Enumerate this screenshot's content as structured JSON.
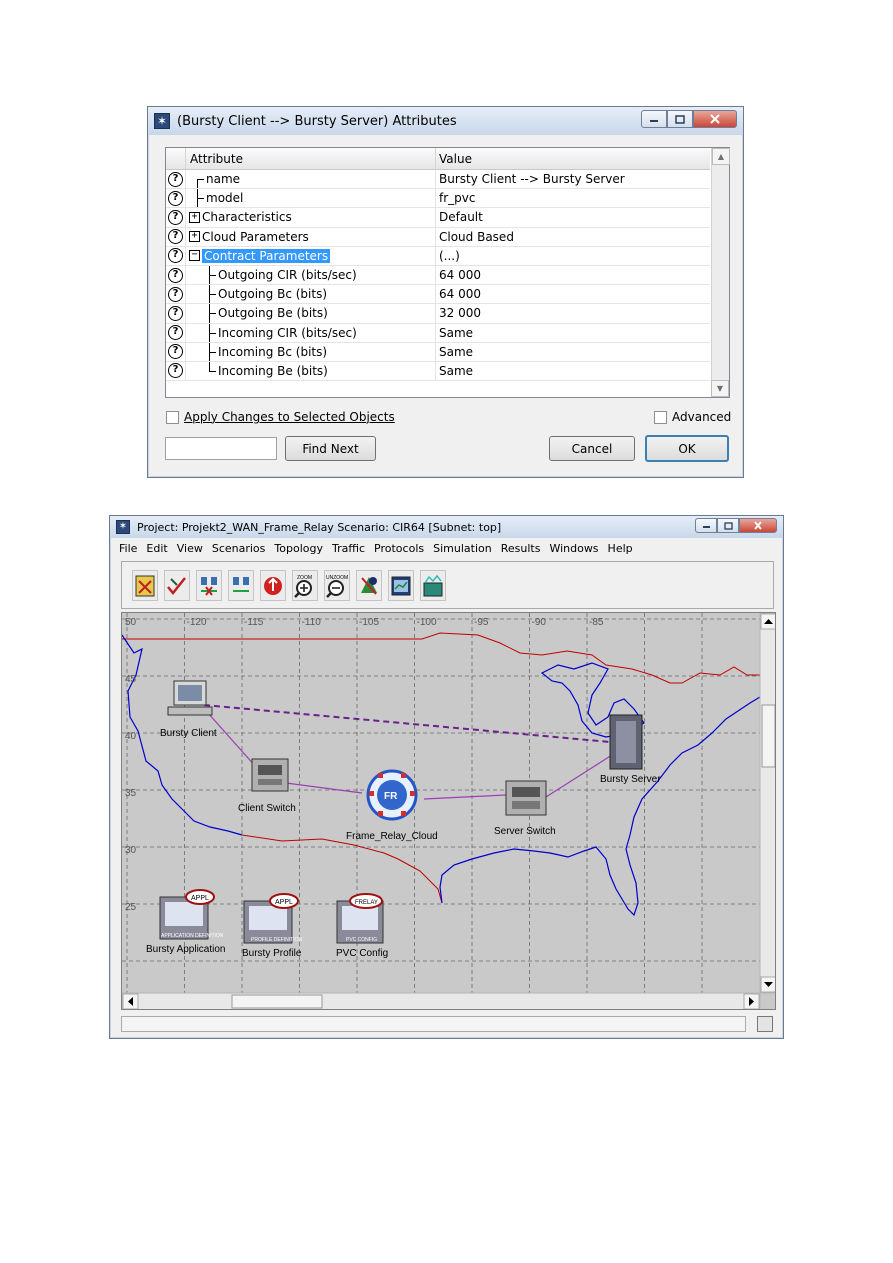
{
  "dialog": {
    "title": "(Bursty Client --> Bursty Server) Attributes",
    "columns": {
      "attribute": "Attribute",
      "value": "Value"
    },
    "rows": [
      {
        "attr": "name",
        "value": "Bursty Client --> Bursty Server",
        "tree": "first",
        "expander": ""
      },
      {
        "attr": "model",
        "value": "fr_pvc",
        "tree": "mid",
        "expander": ""
      },
      {
        "attr": "Characteristics",
        "value": "Default",
        "tree": "",
        "expander": "+"
      },
      {
        "attr": "Cloud Parameters",
        "value": "Cloud Based",
        "tree": "",
        "expander": "+"
      },
      {
        "attr": "Contract Parameters",
        "value": "(...)",
        "tree": "",
        "expander": "−",
        "selected": true
      },
      {
        "attr": "Outgoing CIR (bits/sec)",
        "value": "64 000",
        "tree": "child",
        "expander": ""
      },
      {
        "attr": "Outgoing Bc (bits)",
        "value": "64 000",
        "tree": "child",
        "expander": ""
      },
      {
        "attr": "Outgoing Be (bits)",
        "value": "32 000",
        "tree": "child",
        "expander": ""
      },
      {
        "attr": "Incoming CIR (bits/sec)",
        "value": "Same",
        "tree": "child",
        "expander": ""
      },
      {
        "attr": "Incoming Bc (bits)",
        "value": "Same",
        "tree": "child",
        "expander": ""
      },
      {
        "attr": "Incoming Be (bits)",
        "value": "Same",
        "tree": "childlast",
        "expander": ""
      }
    ],
    "apply_changes_label": "Apply Changes to Selected Objects",
    "advanced_label": "Advanced",
    "find_next_label": "Find Next",
    "find_value": "",
    "cancel_label": "Cancel",
    "ok_label": "OK"
  },
  "main": {
    "title": "Project: Projekt2_WAN_Frame_Relay Scenario: CIR64  [Subnet: top]",
    "menu": [
      "File",
      "Edit",
      "View",
      "Scenarios",
      "Topology",
      "Traffic",
      "Protocols",
      "Simulation",
      "Results",
      "Windows",
      "Help"
    ],
    "toolbar_icons": [
      "object-palette-icon",
      "verify-links-icon",
      "fail-links-icon",
      "recover-links-icon",
      "return-to-parent-icon",
      "zoom-icon",
      "unzoom-icon",
      "simulation-run-icon",
      "view-results-icon",
      "hide-graphs-icon"
    ],
    "zoom_label": "ZOOM",
    "unzoom_label": "UNZOOM",
    "lat_labels": [
      "50",
      "45",
      "40",
      "35",
      "30",
      "25"
    ],
    "lon_labels": [
      "-120",
      "-115",
      "-110",
      "-105",
      "-100",
      "-95",
      "-90",
      "-85"
    ],
    "nodes": {
      "bursty_client": "Bursty Client",
      "client_switch": "Client Switch",
      "frame_relay_cloud": "Frame_Relay_Cloud",
      "cloud_badge": "FR",
      "server_switch": "Server Switch",
      "bursty_server": "Bursty Server",
      "bursty_application": "Bursty Application",
      "app_badge": "APPL",
      "app_caption": "APPLICATION DEFINITION",
      "bursty_profile": "Bursty Profile",
      "profile_badge": "APPL",
      "profile_caption": "PROFILE DEFINITION",
      "pvc_config": "PVC Config",
      "pvc_badge": "FRELAY",
      "pvc_caption": "PVC CONFIG"
    },
    "colors": {
      "map_bg": "#c9c9c9",
      "border_line": "#c00000",
      "coast": "#0000cc",
      "link": "#9b3fb3",
      "selection": "#3399ff"
    }
  }
}
